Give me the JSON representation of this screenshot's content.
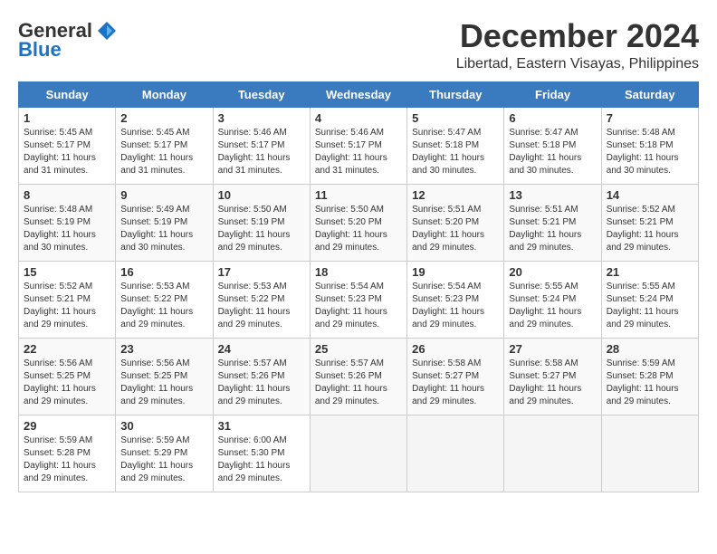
{
  "logo": {
    "general": "General",
    "blue": "Blue"
  },
  "title": "December 2024",
  "location": "Libertad, Eastern Visayas, Philippines",
  "days_header": [
    "Sunday",
    "Monday",
    "Tuesday",
    "Wednesday",
    "Thursday",
    "Friday",
    "Saturday"
  ],
  "weeks": [
    [
      {
        "num": "1",
        "sunrise": "5:45 AM",
        "sunset": "5:17 PM",
        "daylight": "11 hours and 31 minutes"
      },
      {
        "num": "2",
        "sunrise": "5:45 AM",
        "sunset": "5:17 PM",
        "daylight": "11 hours and 31 minutes"
      },
      {
        "num": "3",
        "sunrise": "5:46 AM",
        "sunset": "5:17 PM",
        "daylight": "11 hours and 31 minutes"
      },
      {
        "num": "4",
        "sunrise": "5:46 AM",
        "sunset": "5:17 PM",
        "daylight": "11 hours and 31 minutes"
      },
      {
        "num": "5",
        "sunrise": "5:47 AM",
        "sunset": "5:18 PM",
        "daylight": "11 hours and 30 minutes"
      },
      {
        "num": "6",
        "sunrise": "5:47 AM",
        "sunset": "5:18 PM",
        "daylight": "11 hours and 30 minutes"
      },
      {
        "num": "7",
        "sunrise": "5:48 AM",
        "sunset": "5:18 PM",
        "daylight": "11 hours and 30 minutes"
      }
    ],
    [
      {
        "num": "8",
        "sunrise": "5:48 AM",
        "sunset": "5:19 PM",
        "daylight": "11 hours and 30 minutes"
      },
      {
        "num": "9",
        "sunrise": "5:49 AM",
        "sunset": "5:19 PM",
        "daylight": "11 hours and 30 minutes"
      },
      {
        "num": "10",
        "sunrise": "5:50 AM",
        "sunset": "5:19 PM",
        "daylight": "11 hours and 29 minutes"
      },
      {
        "num": "11",
        "sunrise": "5:50 AM",
        "sunset": "5:20 PM",
        "daylight": "11 hours and 29 minutes"
      },
      {
        "num": "12",
        "sunrise": "5:51 AM",
        "sunset": "5:20 PM",
        "daylight": "11 hours and 29 minutes"
      },
      {
        "num": "13",
        "sunrise": "5:51 AM",
        "sunset": "5:21 PM",
        "daylight": "11 hours and 29 minutes"
      },
      {
        "num": "14",
        "sunrise": "5:52 AM",
        "sunset": "5:21 PM",
        "daylight": "11 hours and 29 minutes"
      }
    ],
    [
      {
        "num": "15",
        "sunrise": "5:52 AM",
        "sunset": "5:21 PM",
        "daylight": "11 hours and 29 minutes"
      },
      {
        "num": "16",
        "sunrise": "5:53 AM",
        "sunset": "5:22 PM",
        "daylight": "11 hours and 29 minutes"
      },
      {
        "num": "17",
        "sunrise": "5:53 AM",
        "sunset": "5:22 PM",
        "daylight": "11 hours and 29 minutes"
      },
      {
        "num": "18",
        "sunrise": "5:54 AM",
        "sunset": "5:23 PM",
        "daylight": "11 hours and 29 minutes"
      },
      {
        "num": "19",
        "sunrise": "5:54 AM",
        "sunset": "5:23 PM",
        "daylight": "11 hours and 29 minutes"
      },
      {
        "num": "20",
        "sunrise": "5:55 AM",
        "sunset": "5:24 PM",
        "daylight": "11 hours and 29 minutes"
      },
      {
        "num": "21",
        "sunrise": "5:55 AM",
        "sunset": "5:24 PM",
        "daylight": "11 hours and 29 minutes"
      }
    ],
    [
      {
        "num": "22",
        "sunrise": "5:56 AM",
        "sunset": "5:25 PM",
        "daylight": "11 hours and 29 minutes"
      },
      {
        "num": "23",
        "sunrise": "5:56 AM",
        "sunset": "5:25 PM",
        "daylight": "11 hours and 29 minutes"
      },
      {
        "num": "24",
        "sunrise": "5:57 AM",
        "sunset": "5:26 PM",
        "daylight": "11 hours and 29 minutes"
      },
      {
        "num": "25",
        "sunrise": "5:57 AM",
        "sunset": "5:26 PM",
        "daylight": "11 hours and 29 minutes"
      },
      {
        "num": "26",
        "sunrise": "5:58 AM",
        "sunset": "5:27 PM",
        "daylight": "11 hours and 29 minutes"
      },
      {
        "num": "27",
        "sunrise": "5:58 AM",
        "sunset": "5:27 PM",
        "daylight": "11 hours and 29 minutes"
      },
      {
        "num": "28",
        "sunrise": "5:59 AM",
        "sunset": "5:28 PM",
        "daylight": "11 hours and 29 minutes"
      }
    ],
    [
      {
        "num": "29",
        "sunrise": "5:59 AM",
        "sunset": "5:28 PM",
        "daylight": "11 hours and 29 minutes"
      },
      {
        "num": "30",
        "sunrise": "5:59 AM",
        "sunset": "5:29 PM",
        "daylight": "11 hours and 29 minutes"
      },
      {
        "num": "31",
        "sunrise": "6:00 AM",
        "sunset": "5:30 PM",
        "daylight": "11 hours and 29 minutes"
      },
      null,
      null,
      null,
      null
    ]
  ]
}
